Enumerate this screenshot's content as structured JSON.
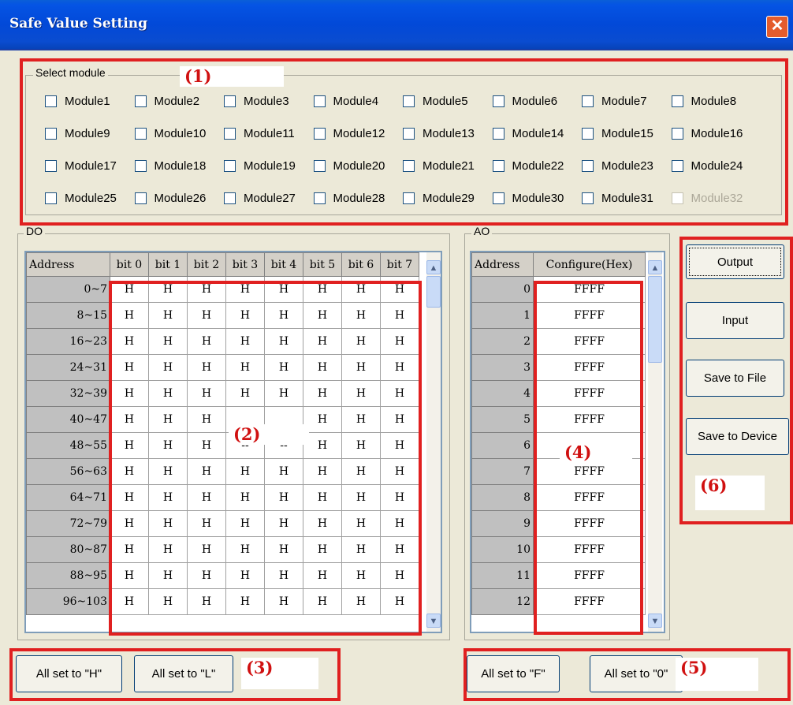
{
  "window": {
    "title": "Safe Value Setting",
    "close_glyph": "✕"
  },
  "modules": {
    "legend": "Select module",
    "items": [
      {
        "label": "Module1",
        "enabled": true
      },
      {
        "label": "Module2",
        "enabled": true
      },
      {
        "label": "Module3",
        "enabled": true
      },
      {
        "label": "Module4",
        "enabled": true
      },
      {
        "label": "Module5",
        "enabled": true
      },
      {
        "label": "Module6",
        "enabled": true
      },
      {
        "label": "Module7",
        "enabled": true
      },
      {
        "label": "Module8",
        "enabled": true
      },
      {
        "label": "Module9",
        "enabled": true
      },
      {
        "label": "Module10",
        "enabled": true
      },
      {
        "label": "Module11",
        "enabled": true
      },
      {
        "label": "Module12",
        "enabled": true
      },
      {
        "label": "Module13",
        "enabled": true
      },
      {
        "label": "Module14",
        "enabled": true
      },
      {
        "label": "Module15",
        "enabled": true
      },
      {
        "label": "Module16",
        "enabled": true
      },
      {
        "label": "Module17",
        "enabled": true
      },
      {
        "label": "Module18",
        "enabled": true
      },
      {
        "label": "Module19",
        "enabled": true
      },
      {
        "label": "Module20",
        "enabled": true
      },
      {
        "label": "Module21",
        "enabled": true
      },
      {
        "label": "Module22",
        "enabled": true
      },
      {
        "label": "Module23",
        "enabled": true
      },
      {
        "label": "Module24",
        "enabled": true
      },
      {
        "label": "Module25",
        "enabled": true
      },
      {
        "label": "Module26",
        "enabled": true
      },
      {
        "label": "Module27",
        "enabled": true
      },
      {
        "label": "Module28",
        "enabled": true
      },
      {
        "label": "Module29",
        "enabled": true
      },
      {
        "label": "Module30",
        "enabled": true
      },
      {
        "label": "Module31",
        "enabled": true
      },
      {
        "label": "Module32",
        "enabled": false
      }
    ]
  },
  "do_group": {
    "legend": "DO",
    "headers": [
      "Address",
      "bit 0",
      "bit 1",
      "bit 2",
      "bit 3",
      "bit 4",
      "bit 5",
      "bit 6",
      "bit 7"
    ],
    "rows": [
      [
        "0~7",
        "H",
        "H",
        "H",
        "H",
        "H",
        "H",
        "H",
        "H"
      ],
      [
        "8~15",
        "H",
        "H",
        "H",
        "H",
        "H",
        "H",
        "H",
        "H"
      ],
      [
        "16~23",
        "H",
        "H",
        "H",
        "H",
        "H",
        "H",
        "H",
        "H"
      ],
      [
        "24~31",
        "H",
        "H",
        "H",
        "H",
        "H",
        "H",
        "H",
        "H"
      ],
      [
        "32~39",
        "H",
        "H",
        "H",
        "H",
        "H",
        "H",
        "H",
        "H"
      ],
      [
        "40~47",
        "H",
        "H",
        "H",
        "",
        "",
        "H",
        "H",
        "H"
      ],
      [
        "48~55",
        "H",
        "H",
        "H",
        "--",
        "--",
        "H",
        "H",
        "H"
      ],
      [
        "56~63",
        "H",
        "H",
        "H",
        "H",
        "H",
        "H",
        "H",
        "H"
      ],
      [
        "64~71",
        "H",
        "H",
        "H",
        "H",
        "H",
        "H",
        "H",
        "H"
      ],
      [
        "72~79",
        "H",
        "H",
        "H",
        "H",
        "H",
        "H",
        "H",
        "H"
      ],
      [
        "80~87",
        "H",
        "H",
        "H",
        "H",
        "H",
        "H",
        "H",
        "H"
      ],
      [
        "88~95",
        "H",
        "H",
        "H",
        "H",
        "H",
        "H",
        "H",
        "H"
      ],
      [
        "96~103",
        "H",
        "H",
        "H",
        "H",
        "H",
        "H",
        "H",
        "H"
      ]
    ]
  },
  "ao_group": {
    "legend": "AO",
    "headers": [
      "Address",
      "Configure(Hex)"
    ],
    "rows": [
      [
        "0",
        "FFFF"
      ],
      [
        "1",
        "FFFF"
      ],
      [
        "2",
        "FFFF"
      ],
      [
        "3",
        "FFFF"
      ],
      [
        "4",
        "FFFF"
      ],
      [
        "5",
        "FFFF"
      ],
      [
        "6",
        ""
      ],
      [
        "7",
        "FFFF"
      ],
      [
        "8",
        "FFFF"
      ],
      [
        "9",
        "FFFF"
      ],
      [
        "10",
        "FFFF"
      ],
      [
        "11",
        "FFFF"
      ],
      [
        "12",
        "FFFF"
      ]
    ]
  },
  "buttons": {
    "output": "Output",
    "input": "Input",
    "save_file": "Save to File",
    "save_device": "Save to Device",
    "all_h": "All set to \"H\"",
    "all_l": "All set to \"L\"",
    "all_f": "All set to \"F\"",
    "all_0": "All set to \"0\""
  },
  "annotations": [
    "(1)",
    "(2)",
    "(3)",
    "(4)",
    "(5)",
    "(6)"
  ],
  "colors": {
    "title_bar": "#0454e0",
    "annotation": "#e02020",
    "dialog_bg": "#ece9d8"
  }
}
